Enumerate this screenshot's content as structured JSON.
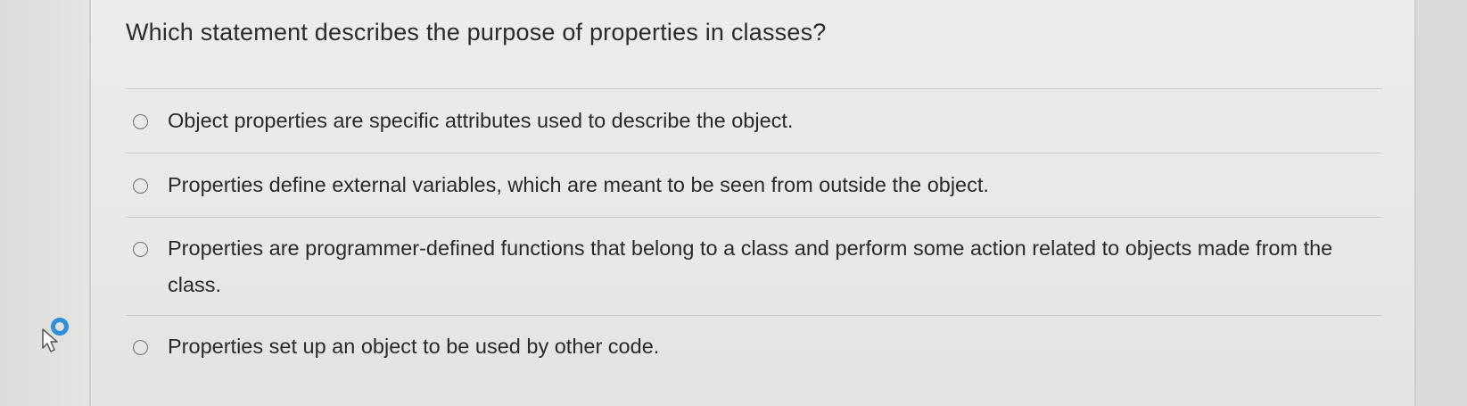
{
  "question": {
    "text": "Which statement describes the purpose of properties in classes?"
  },
  "options": [
    {
      "label": "Object properties are specific attributes used to describe the object."
    },
    {
      "label": "Properties define external variables, which are meant to be seen from outside the object."
    },
    {
      "label": "Properties are programmer-defined functions that belong to a class and perform some action related to objects made from the class."
    },
    {
      "label": "Properties set up an object to be used by other code."
    }
  ],
  "colors": {
    "background": "#e8e8e6",
    "text": "#2a2a2a",
    "divider": "#cacac8",
    "radio_border": "#6f6f6f",
    "cursor_ring": "#2f8fd8"
  },
  "icons": {
    "cursor": "mouse-pointer-icon",
    "busy": "loading-ring-icon"
  }
}
